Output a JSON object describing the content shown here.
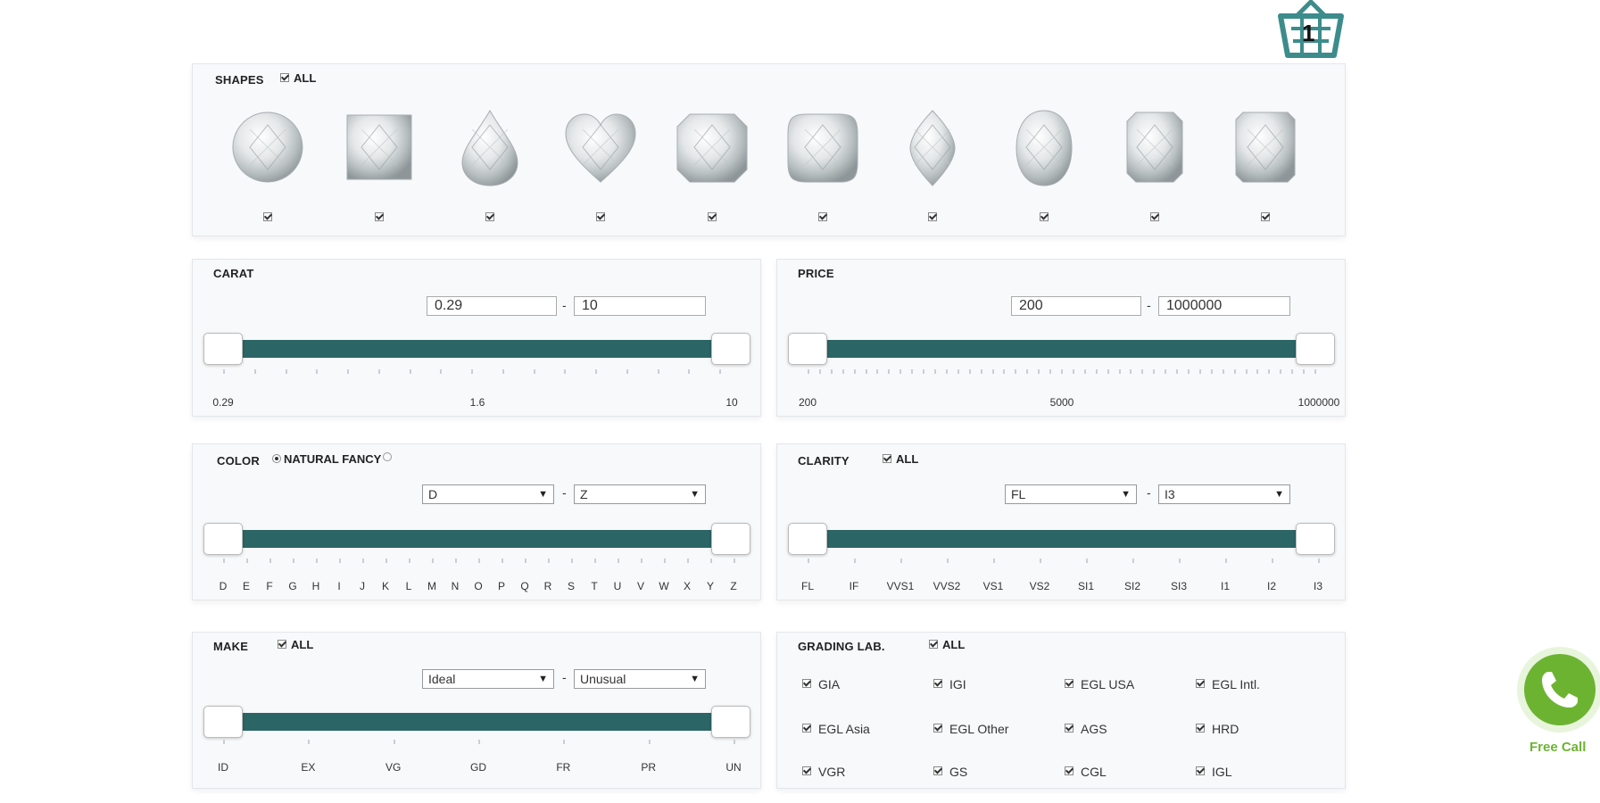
{
  "cart": {
    "count": "1"
  },
  "shapes": {
    "title": "SHAPES",
    "all_label": "ALL",
    "items": [
      {
        "name": "round",
        "checked": true
      },
      {
        "name": "princess",
        "checked": true
      },
      {
        "name": "pear",
        "checked": true
      },
      {
        "name": "heart",
        "checked": true
      },
      {
        "name": "asscher",
        "checked": true
      },
      {
        "name": "cushion",
        "checked": true
      },
      {
        "name": "marquise",
        "checked": true
      },
      {
        "name": "oval",
        "checked": true
      },
      {
        "name": "emerald",
        "checked": true
      },
      {
        "name": "radiant",
        "checked": true
      }
    ]
  },
  "carat": {
    "title": "CARAT",
    "min_value": "0.29",
    "max_value": "10",
    "separator": "-",
    "scale_labels": [
      "0.29",
      "1.6",
      "10"
    ]
  },
  "price": {
    "title": "PRICE",
    "min_value": "200",
    "max_value": "1000000",
    "separator": "-",
    "scale_labels": [
      "200",
      "5000",
      "1000000"
    ]
  },
  "color": {
    "title": "COLOR",
    "natural_fancy_label": "NATURAL FANCY",
    "min_select": "D",
    "max_select": "Z",
    "separator": "-",
    "grades": [
      "D",
      "E",
      "F",
      "G",
      "H",
      "I",
      "J",
      "K",
      "L",
      "M",
      "N",
      "O",
      "P",
      "Q",
      "R",
      "S",
      "T",
      "U",
      "V",
      "W",
      "X",
      "Y",
      "Z"
    ]
  },
  "clarity": {
    "title": "CLARITY",
    "all_label": "ALL",
    "min_select": "FL",
    "max_select": "I3",
    "separator": "-",
    "grades": [
      "FL",
      "IF",
      "VVS1",
      "VVS2",
      "VS1",
      "VS2",
      "SI1",
      "SI2",
      "SI3",
      "I1",
      "I2",
      "I3"
    ]
  },
  "make": {
    "title": "MAKE",
    "all_label": "ALL",
    "min_select": "Ideal",
    "max_select": "Unusual",
    "separator": "-",
    "grades": [
      "ID",
      "EX",
      "VG",
      "GD",
      "FR",
      "PR",
      "UN"
    ]
  },
  "grading_lab": {
    "title": "GRADING LAB.",
    "all_label": "ALL",
    "labs": [
      "GIA",
      "IGI",
      "EGL USA",
      "EGL Intl.",
      "EGL Asia",
      "EGL Other",
      "AGS",
      "HRD",
      "VGR",
      "GS",
      "CGL",
      "IGL"
    ]
  },
  "call": {
    "label": "Free Call"
  },
  "colors": {
    "accent": "#2c6566",
    "call_green": "#6db332"
  }
}
